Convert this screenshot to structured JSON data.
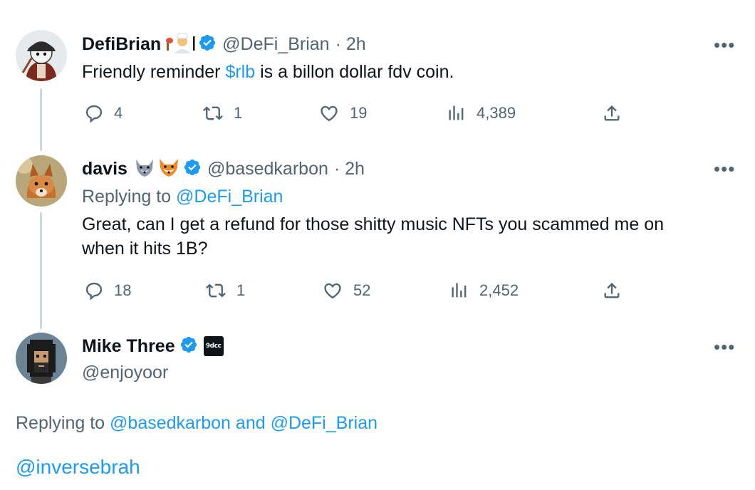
{
  "tweets": [
    {
      "display_name": "DefiBrian",
      "handle": "@DeFi_Brian",
      "time": "· 2h",
      "text_before": "Friendly reminder ",
      "cashtag": "$rlb",
      "text_after": " is a billon dollar fdv coin.",
      "replies": "4",
      "retweets": "1",
      "likes": "19",
      "views": "4,389"
    },
    {
      "display_name": "davis",
      "handle": "@basedkarbon",
      "time": "· 2h",
      "replying_label": "Replying to ",
      "replying_to": "@DeFi_Brian",
      "text_line1": "Great, can I get a refund for those shitty music NFTs you scammed me on",
      "text_line2": "when it hits 1B?",
      "replies": "18",
      "retweets": "1",
      "likes": "52",
      "views": "2,452"
    },
    {
      "display_name": "Mike Three",
      "handle": "@enjoyoor",
      "badge_label": "9dcc",
      "replying_label": "Replying to ",
      "replying_to_1": "@basedkarbon",
      "replying_and": " and ",
      "replying_to_2": "@DeFi_Brian",
      "text": "@inversebrah"
    }
  ],
  "more_label": "•••",
  "colors": {
    "link": "#1d9bf0",
    "muted": "#536471",
    "verified": "#1d9bf0",
    "thread_line": "#cfd9de"
  },
  "icons": [
    "reply-icon",
    "retweet-icon",
    "like-icon",
    "views-icon",
    "share-icon",
    "verified-icon",
    "more-icon"
  ]
}
